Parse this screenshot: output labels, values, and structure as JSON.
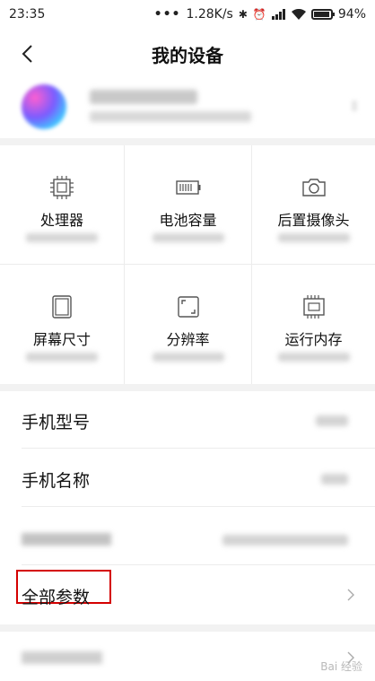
{
  "status_bar": {
    "time": "23:35",
    "network_speed": "1.28K/s",
    "battery": "94%",
    "battery_level": 0.94
  },
  "header": {
    "title": "我的设备"
  },
  "spec_grid": [
    {
      "label": "处理器",
      "icon": "processor-icon"
    },
    {
      "label": "电池容量",
      "icon": "battery-icon"
    },
    {
      "label": "后置摄像头",
      "icon": "camera-icon"
    },
    {
      "label": "屏幕尺寸",
      "icon": "screen-icon"
    },
    {
      "label": "分辨率",
      "icon": "resolution-icon"
    },
    {
      "label": "运行内存",
      "icon": "memory-icon"
    }
  ],
  "info_list": {
    "model_label": "手机型号",
    "name_label": "手机名称",
    "all_params_label": "全部参数"
  },
  "accent": {
    "highlight_border": "#d40000"
  },
  "watermark": "Bai 经验"
}
